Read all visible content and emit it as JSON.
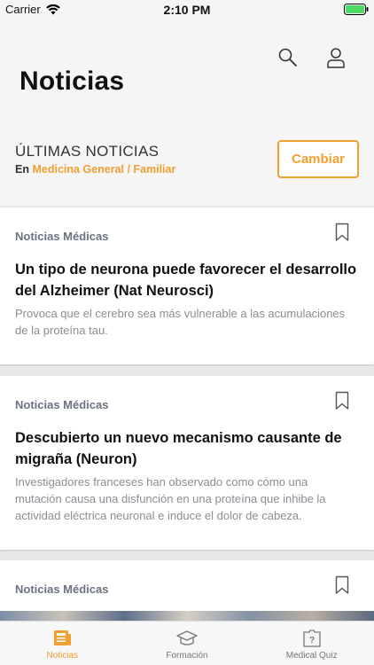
{
  "status": {
    "carrier": "Carrier",
    "time": "2:10 PM"
  },
  "header": {
    "title": "Noticias",
    "section_title": "ÚLTIMAS NOTICIAS",
    "section_prefix": "En",
    "specialty": "Medicina General / Familiar",
    "change_label": "Cambiar"
  },
  "icons": {
    "search": "search-icon",
    "profile": "user-icon",
    "bookmark": "bookmark-icon"
  },
  "colors": {
    "accent": "#f0a030",
    "category": "#6b7280",
    "summary": "#8a8e94",
    "background": "#f5f5f5"
  },
  "articles": [
    {
      "category": "Noticias Médicas",
      "title": "Un tipo de neurona puede favorecer el desarrollo del Alzheimer (Nat Neurosci)",
      "summary": "Provoca que el cerebro sea más vulnerable a las acumulaciones de la proteína tau."
    },
    {
      "category": "Noticias Médicas",
      "title": "Descubierto un nuevo mecanismo causante de migraña (Neuron)",
      "summary": "Investigadores franceses han observado como cómo una mutación causa una disfunción en una proteína que inhibe la actividad eléctrica neuronal e induce el dolor de cabeza."
    },
    {
      "category": "Noticias Médicas"
    }
  ],
  "tabs": [
    {
      "label": "Noticias",
      "icon": "news-icon",
      "active": true
    },
    {
      "label": "Formación",
      "icon": "graduation-cap-icon",
      "active": false
    },
    {
      "label": "Medical Quiz",
      "icon": "quiz-icon",
      "active": false
    }
  ]
}
